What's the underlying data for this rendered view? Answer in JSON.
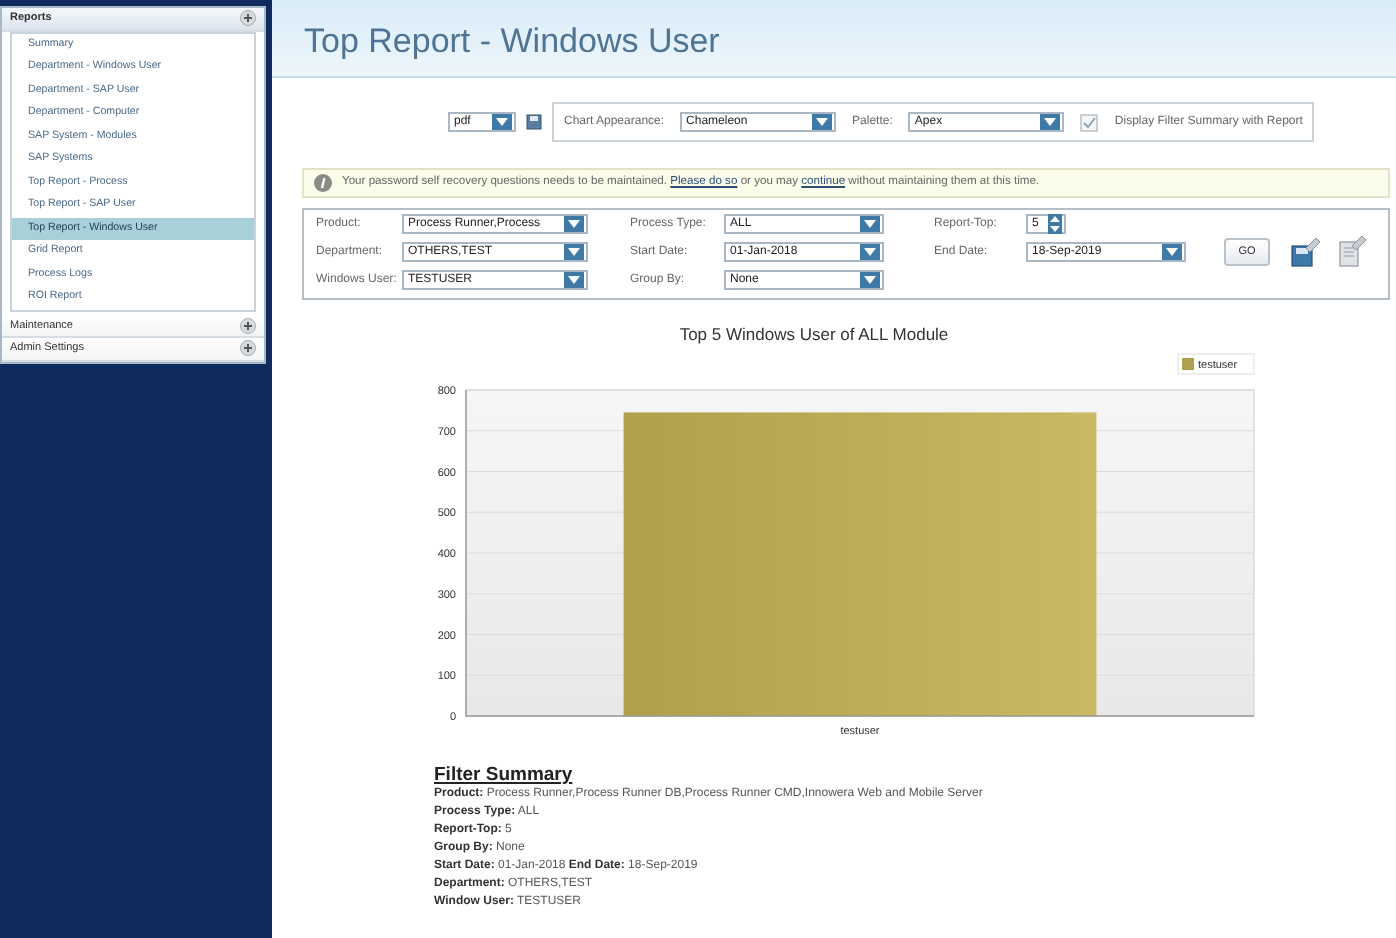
{
  "sidebar": {
    "sections": [
      {
        "label": "Reports",
        "expanded": true,
        "items": [
          {
            "label": "Summary",
            "selected": false
          },
          {
            "label": "Department - Windows User",
            "selected": false
          },
          {
            "label": "Department - SAP User",
            "selected": false
          },
          {
            "label": "Department - Computer",
            "selected": false
          },
          {
            "label": "SAP System - Modules",
            "selected": false
          },
          {
            "label": "SAP Systems",
            "selected": false
          },
          {
            "label": "Top Report - Process",
            "selected": false
          },
          {
            "label": "Top Report - SAP User",
            "selected": false
          },
          {
            "label": "Top Report - Windows User",
            "selected": true
          },
          {
            "label": "Grid Report",
            "selected": false
          },
          {
            "label": "Process Logs",
            "selected": false
          },
          {
            "label": "ROI Report",
            "selected": false
          }
        ]
      },
      {
        "label": "Maintenance",
        "expanded": false
      },
      {
        "label": "Admin Settings",
        "expanded": false
      }
    ]
  },
  "page_title": "Top Report - Windows User",
  "export": {
    "format": "pdf"
  },
  "chart_options": {
    "appearance_label": "Chart Appearance:",
    "appearance": "Chameleon",
    "palette_label": "Palette:",
    "palette": "Apex",
    "filter_summary_option": {
      "label": "Display Filter Summary with Report",
      "checked": true
    }
  },
  "alert": {
    "parts": [
      {
        "kind": "text",
        "text": "Your password self recovery questions needs to be maintained."
      },
      {
        "kind": "link",
        "text": "Please do so"
      },
      {
        "kind": "text",
        "text": "or you may"
      },
      {
        "kind": "link",
        "text": "continue"
      },
      {
        "kind": "text",
        "text": "without maintaining them at this time."
      }
    ]
  },
  "filters": [
    [
      {
        "label": "Product:",
        "value": "Process Runner,Process",
        "kind": "dropdown"
      },
      {
        "label": "Process Type:",
        "value": "ALL",
        "kind": "dropdown"
      },
      {
        "label": "Report-Top:",
        "value": "5",
        "kind": "spinner"
      }
    ],
    [
      {
        "label": "Department:",
        "value": "OTHERS,TEST",
        "kind": "dropdown"
      },
      {
        "label": "Start Date:",
        "value": "01-Jan-2018",
        "kind": "dropdown"
      },
      {
        "label": "End Date:",
        "value": "18-Sep-2019",
        "kind": "dropdown"
      }
    ],
    [
      {
        "label": "Windows User:",
        "value": "TESTUSER",
        "kind": "dropdown"
      },
      {
        "label": "Group By:",
        "value": "None",
        "kind": "dropdown"
      }
    ]
  ],
  "go_button": "GO",
  "chart": {
    "chart_data": {
      "type": "bar",
      "title": "Top 5 Windows User of ALL Module",
      "categories": [
        "testuser"
      ],
      "series": [
        {
          "name": "testuser",
          "color": "#b0a04c",
          "values": [
            745
          ]
        }
      ],
      "grid": true,
      "ylim": [
        0,
        800
      ],
      "yticks": [
        0,
        100,
        200,
        300,
        400,
        500,
        600,
        700,
        800
      ]
    }
  },
  "filter_summary": {
    "title": "Filter Summary",
    "lines": [
      "**Product:** Process Runner,Process Runner DB,Process Runner CMD,Innowera Web and Mobile Server",
      "**Process Type:** ALL",
      "**Report-Top:** 5",
      "**Group By:** None",
      "**Start Date:** 01-Jan-2018 **End Date:** 18-Sep-2019",
      "**Department:** OTHERS,TEST",
      "**Window User:** TESTUSER"
    ]
  }
}
